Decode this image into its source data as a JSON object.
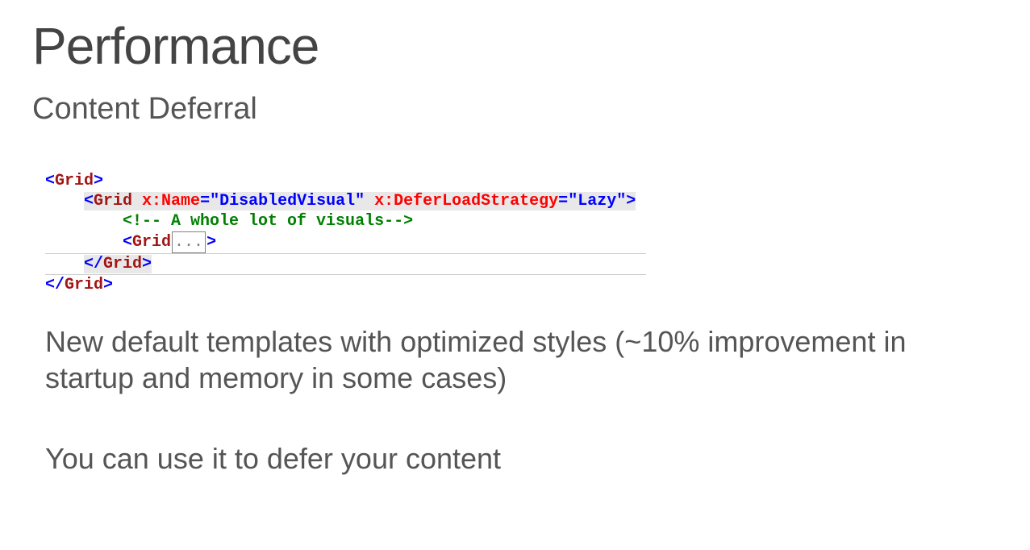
{
  "title": "Performance",
  "subtitle": "Content Deferral",
  "code": {
    "l1_open": "<",
    "l1_elem": "Grid",
    "l1_close": ">",
    "l2_open": "<",
    "l2_elem": "Grid ",
    "l2_attr1": "x:Name",
    "l2_eq1": "=",
    "l2_val1": "\"DisabledVisual\" ",
    "l2_attr2": "x:DeferLoadStrategy",
    "l2_eq2": "=",
    "l2_val2": "\"Lazy\"",
    "l2_close": ">",
    "l3_comment": "<!-- A whole lot of visuals-->",
    "l4_open": "<",
    "l4_elem": "Grid",
    "l4_fold": "...",
    "l4_close": ">",
    "l5_open": "</",
    "l5_elem": "Grid",
    "l5_close": ">",
    "l6_open": "</",
    "l6_elem": "Grid",
    "l6_close": ">"
  },
  "body1": "New default templates with optimized styles (~10% improvement in startup and memory in some cases)",
  "body2": "You can use it to defer your content"
}
